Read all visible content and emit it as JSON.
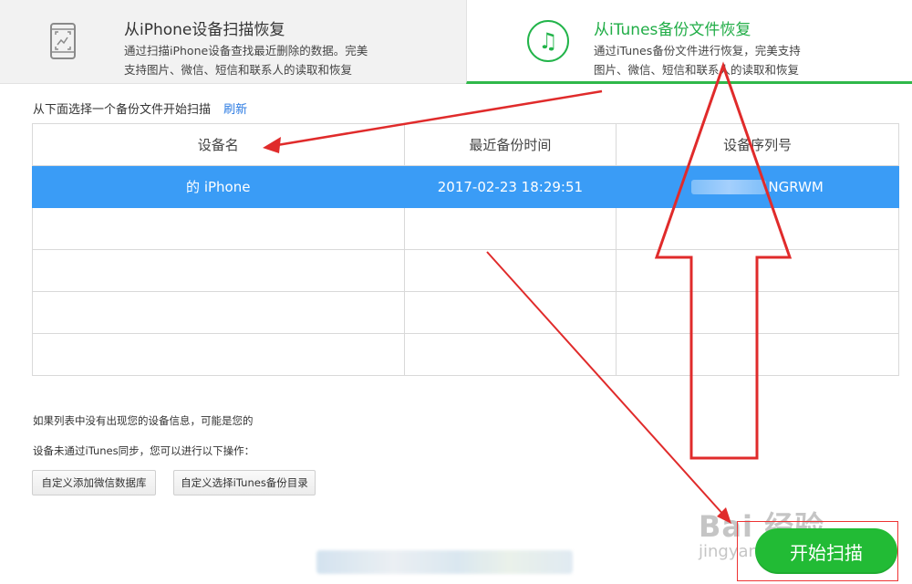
{
  "tabs": {
    "left": {
      "title": "从iPhone设备扫描恢复",
      "desc_line1": "通过扫描iPhone设备查找最近删除的数据。完美",
      "desc_line2": "支持图片、微信、短信和联系人的读取和恢复",
      "icon": "phone-scan-icon"
    },
    "right": {
      "title": "从iTunes备份文件恢复",
      "desc_line1": "通过iTunes备份文件进行恢复，完美支持",
      "desc_line2": "图片、微信、短信和联系人的读取和恢复",
      "icon": "music-note-icon",
      "icon_glyph": "♫"
    }
  },
  "select": {
    "prompt": "从下面选择一个备份文件开始扫描",
    "refresh": "刷新"
  },
  "table": {
    "headers": [
      "设备名",
      "最近备份时间",
      "设备序列号"
    ],
    "rows": [
      {
        "device": "的 iPhone",
        "time": "2017-02-23 18:29:51",
        "serial": "NGRWM"
      }
    ]
  },
  "notice": {
    "line1": "如果列表中没有出现您的设备信息，可能是您的",
    "line2": "设备未通过iTunes同步，您可以进行以下操作："
  },
  "buttons": {
    "custom_wechat": "自定义添加微信数据库",
    "custom_itunes": "自定义选择iTunes备份目录",
    "start_scan": "开始扫描"
  },
  "watermark": {
    "logo": "Bai 经验",
    "url": "jingyan.baidu.com"
  },
  "colors": {
    "accent_green": "#22bb35",
    "selected_row": "#3a9cf6",
    "link": "#2a7ae2",
    "annotation_red": "#e02b2b"
  }
}
